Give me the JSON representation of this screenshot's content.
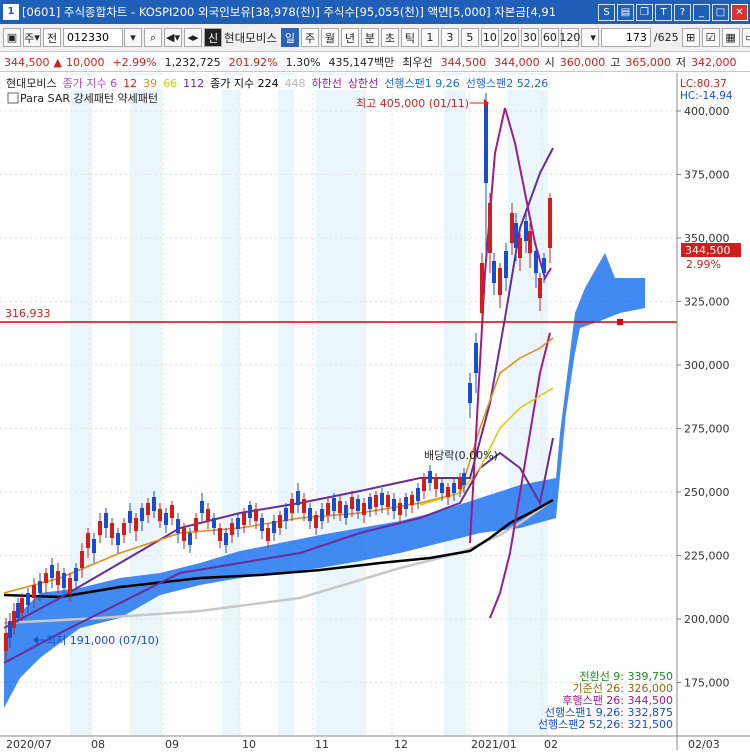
{
  "window": {
    "app_icon": "1",
    "title": "[0601] 주식종합차트 - KOSPI200 외국인보유[38,978(천)] 주식수[95,055(천)] 액면[5,000] 자본금[4,91",
    "buttons": [
      "S",
      "?"
    ]
  },
  "toolbar": {
    "mode": "주",
    "period_label": "전",
    "code": "012330",
    "stock_name": "현대모비스",
    "name_badge": "신",
    "period_buttons": [
      "일",
      "주",
      "월",
      "년",
      "분",
      "초",
      "틱"
    ],
    "active_period": "일",
    "interval_buttons": [
      "1",
      "3",
      "5",
      "10",
      "20",
      "30",
      "60",
      "120"
    ],
    "page": "173",
    "total": "/625"
  },
  "infobar": {
    "price": "344,500",
    "change_arrow": "▲",
    "change": "10,000",
    "change_pct": "+2.99%",
    "volume": "1,232,725",
    "volume_ratio": "201.92%",
    "turnover_pct": "1.30%",
    "amount": "435,147백만",
    "best_label": "최우선",
    "ask": "344,500",
    "bid": "344,000",
    "open_label": "시",
    "open": "360,000",
    "high_label": "고",
    "high": "365,000",
    "low_label": "저",
    "low": "342,000"
  },
  "legend": {
    "line1": [
      {
        "text": "현대모비스",
        "color": "#222222"
      },
      {
        "text": "종가 지수 6",
        "color": "#b04ad0"
      },
      {
        "text": "12",
        "color": "#d21d1d"
      },
      {
        "text": "39",
        "color": "#e88a10"
      },
      {
        "text": "66",
        "color": "#d8d000"
      },
      {
        "text": "112",
        "color": "#6a2c9a"
      },
      {
        "text": "종가 지수 224",
        "color": "#000000"
      },
      {
        "text": "448",
        "color": "#b8b8b8"
      },
      {
        "text": "하한선",
        "color": "#a01a8a"
      },
      {
        "text": "상한선",
        "color": "#a01a8a"
      },
      {
        "text": "선행스팬1 9,26",
        "color": "#1a6ae0"
      },
      {
        "text": "선행스팬2 52,26",
        "color": "#1a6ae0"
      }
    ],
    "line2": "Para SAR 강세패턴 약세패턴",
    "lc": "LC:80.37",
    "hc": "HC:-14.94"
  },
  "chart": {
    "price_badge": "344,500",
    "price_badge_pct": "2.99%",
    "hline_label": "316,933",
    "hline_value": 316933,
    "max_annotation": "최고 405,000 (01/11)",
    "min_annotation": "최저 191,000 (07/10)",
    "dividend_annotation": "배당락(0.00%)",
    "y_ticks": [
      "175,000",
      "200,000",
      "225,000",
      "250,000",
      "275,000",
      "300,000",
      "325,000",
      "350,000",
      "375,000",
      "400,000"
    ],
    "x_labels": [
      "2020/07",
      "08",
      "09",
      "10",
      "11",
      "12",
      "2021/01",
      "02",
      "02/03"
    ],
    "ichimoku": [
      {
        "text": "전환선 9: 339,750",
        "color": "#1a8a2a"
      },
      {
        "text": "기준선 26: 326,000",
        "color": "#8a6a1a"
      },
      {
        "text": "후행스팬 26: 344,500",
        "color": "#a01a8a"
      },
      {
        "text": "선행스팬1 9,26: 332,875",
        "color": "#1a4cd1"
      },
      {
        "text": "선행스팬2 52,26: 321,500",
        "color": "#1a4cd1"
      }
    ]
  },
  "colors": {
    "up": "#d21d1d",
    "down": "#1a4cd1",
    "cloud": "#2c7df0",
    "band": "#eaf6fb"
  }
}
